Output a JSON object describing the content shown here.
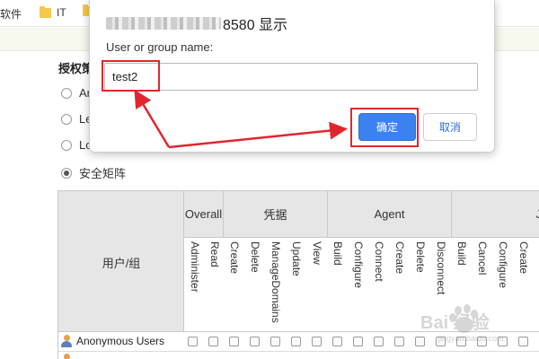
{
  "bookmarks": [
    {
      "label": "软件",
      "folder": false
    },
    {
      "label": "IT",
      "folder": true
    },
    {
      "label": "",
      "folder": true
    }
  ],
  "section": {
    "title": "授权策"
  },
  "radio_options": [
    {
      "label": "An",
      "checked": false
    },
    {
      "label": "Le",
      "checked": false
    },
    {
      "label": "Lo",
      "checked": false
    },
    {
      "label": "安全矩阵",
      "checked": true
    }
  ],
  "matrix": {
    "users_header": "用户/组",
    "groups": [
      {
        "label": "Overall"
      },
      {
        "label": "凭据"
      },
      {
        "label": "Agent"
      },
      {
        "label": "J"
      }
    ],
    "permissions": [
      "Administer",
      "Read",
      "Create",
      "Delete",
      "ManageDomains",
      "Update",
      "View",
      "Build",
      "Configure",
      "Connect",
      "Create",
      "Delete",
      "Disconnect",
      "Build",
      "Cancel",
      "Configure",
      "Create"
    ],
    "rows": [
      {
        "name": "Anonymous Users"
      }
    ]
  },
  "dialog": {
    "title_suffix": "8580 显示",
    "field_label": "User or group name:",
    "input_value": "test2",
    "ok_label": "确定",
    "cancel_label": "取消"
  },
  "annotation": {
    "color": "#e0262e"
  },
  "watermark": {
    "text": "Bai 经验",
    "site": "jingyan.baidu.com"
  },
  "colors": {
    "primary_button": "#3b82f0",
    "header_bg": "#e6e6e6"
  }
}
